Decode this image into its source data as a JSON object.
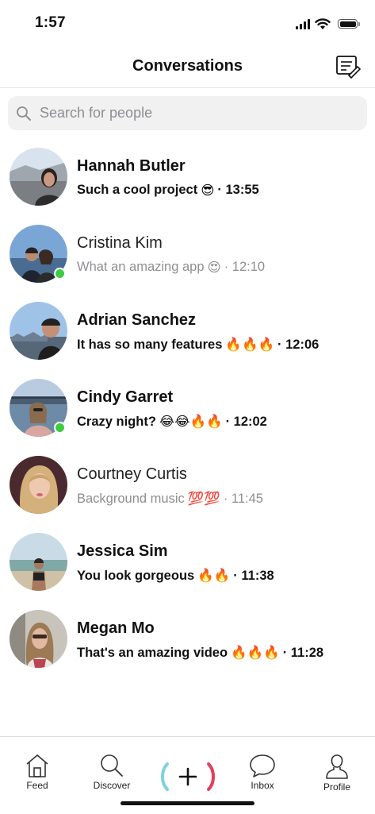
{
  "status_bar": {
    "time": "1:57"
  },
  "header": {
    "title": "Conversations"
  },
  "search": {
    "placeholder": "Search for people"
  },
  "conversations": [
    {
      "name": "Hannah Butler",
      "message": "Such a cool project",
      "emoji": "😎",
      "time": "· 13:55",
      "unread": true,
      "online": false
    },
    {
      "name": "Cristina Kim",
      "message": "What an amazing app",
      "emoji": "😍",
      "time": "· 12:10",
      "unread": false,
      "online": true
    },
    {
      "name": "Adrian Sanchez",
      "message": "It has so many features",
      "emoji": "🔥🔥🔥",
      "time": "· 12:06",
      "unread": true,
      "online": false
    },
    {
      "name": "Cindy Garret",
      "message": "Crazy night?",
      "emoji": "😂😂🔥🔥",
      "time": "· 12:02",
      "unread": true,
      "online": true
    },
    {
      "name": "Courtney Curtis",
      "message": "Background music",
      "emoji": "💯💯",
      "time": "· 11:45",
      "unread": false,
      "online": false
    },
    {
      "name": "Jessica Sim",
      "message": "You look gorgeous",
      "emoji": "🔥🔥",
      "time": "· 11:38",
      "unread": true,
      "online": false
    },
    {
      "name": "Megan Mo",
      "message": "That's an amazing video",
      "emoji": "🔥🔥🔥",
      "time": "· 11:28",
      "unread": true,
      "online": false
    }
  ],
  "tabs": {
    "feed": "Feed",
    "discover": "Discover",
    "inbox": "Inbox",
    "profile": "Profile"
  },
  "colors": {
    "online": "#3fcb44",
    "create_left": "#7fd3d9",
    "create_right": "#e0405d",
    "search_bg": "#f1f1f2"
  },
  "icons": {
    "compose": "compose-icon",
    "search": "search-icon",
    "feed": "home-icon",
    "discover": "magnifier-icon",
    "create": "plus-icon",
    "inbox": "chat-bubble-icon",
    "profile": "person-icon"
  }
}
